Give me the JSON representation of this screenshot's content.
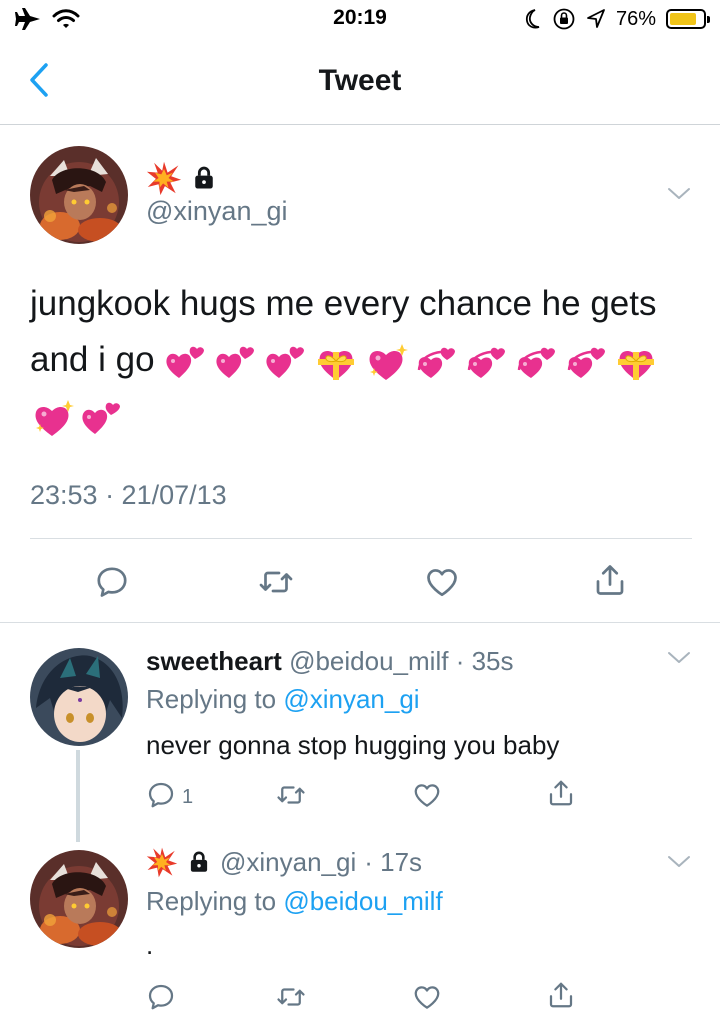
{
  "status_bar": {
    "time": "20:19",
    "battery_percent_label": "76%",
    "battery_level": 0.76,
    "icons": [
      "airplane-icon",
      "wifi-icon",
      "moon-icon",
      "orientation-lock-icon",
      "location-arrow-icon",
      "battery-icon"
    ]
  },
  "header": {
    "title": "Tweet",
    "back_icon": "chevron-left-icon"
  },
  "main_tweet": {
    "handle": "@xinyan_gi",
    "name_icons": [
      "collision-emoji",
      "lock-icon"
    ],
    "text": "jungkook hugs me every chance he gets and i go",
    "emojis": [
      "two-hearts",
      "two-hearts",
      "two-hearts",
      "heart-with-ribbon",
      "sparkling-heart",
      "revolving-hearts",
      "revolving-hearts",
      "revolving-hearts",
      "revolving-hearts",
      "heart-with-ribbon",
      "sparkling-heart",
      "two-hearts"
    ],
    "timestamp": "23:53 · 21/07/13",
    "actions": [
      "reply-icon",
      "retweet-icon",
      "like-icon",
      "share-icon"
    ]
  },
  "replies": [
    {
      "display_name": "sweetheart",
      "handle": "@beidou_milf",
      "time": "· 35s",
      "replying_label": "Replying to",
      "replying_to": "@xinyan_gi",
      "text": "never gonna stop hugging you baby",
      "reply_count": "1"
    },
    {
      "display_name": "",
      "handle": "@xinyan_gi",
      "time": "· 17s",
      "replying_label": "Replying to",
      "replying_to": "@beidou_milf",
      "text": ".",
      "reply_count": ""
    }
  ],
  "colors": {
    "accent": "#1da1f2",
    "muted_text": "#657786",
    "divider": "#d9dee2",
    "battery_fill": "#f0c419",
    "heart_pink": "#e8318f"
  }
}
